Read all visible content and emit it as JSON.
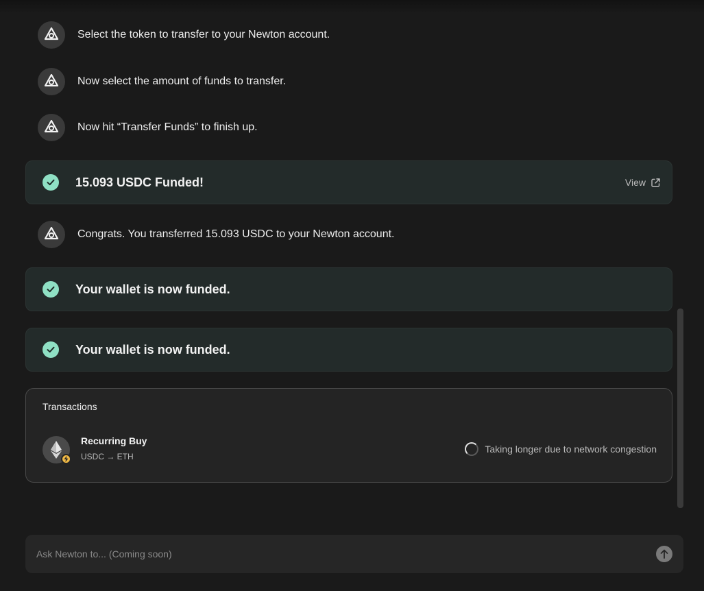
{
  "messages": [
    {
      "text": "Select the token to transfer to your Newton account.",
      "icon": "newton-logo-icon"
    },
    {
      "text": "Now select the amount of funds to transfer.",
      "icon": "newton-logo-icon"
    },
    {
      "text": "Now hit “Transfer Funds” to finish up.",
      "icon": "newton-logo-icon"
    },
    {
      "text": "Congrats. You transferred 15.093 USDC to your Newton account.",
      "icon": "newton-logo-icon"
    }
  ],
  "cards": [
    {
      "text": "15.093 USDC Funded!",
      "link_label": "View",
      "icon": "check-circle-icon"
    },
    {
      "text": "Your wallet is now funded.",
      "icon": "check-circle-icon"
    },
    {
      "text": "Your wallet is now funded.",
      "icon": "check-circle-icon"
    }
  ],
  "transactions": {
    "title": "Transactions",
    "items": [
      {
        "name": "Recurring Buy",
        "pair": "USDC → ETH",
        "status": "Taking longer due to network congestion",
        "icon": "ethereum-icon",
        "badge_icon": "bolt-icon"
      }
    ]
  },
  "input": {
    "placeholder": "Ask Newton to... (Coming soon)",
    "send_icon": "arrow-up-icon"
  },
  "colors": {
    "background": "#1a1a1a",
    "card_background": "#232b2a",
    "check_accent": "#8fe0c4",
    "bolt_badge": "#f0b945"
  }
}
